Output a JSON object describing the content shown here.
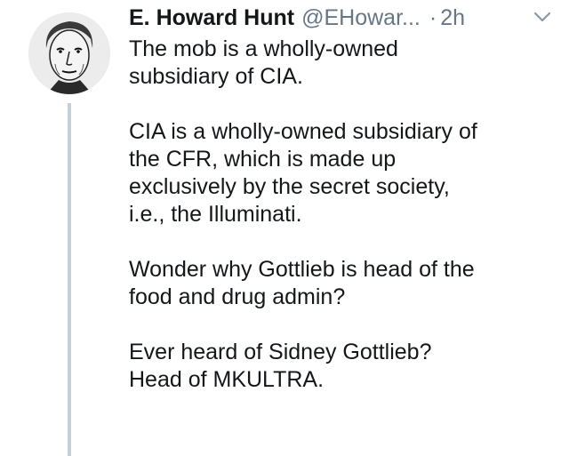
{
  "tweet": {
    "author_name": "E. Howard Hunt",
    "handle": "@EHowar...",
    "separator": "·",
    "time": "2h",
    "paragraphs": [
      [
        "The mob is a wholly-owned",
        "subsidiary of CIA."
      ],
      [
        "CIA is a wholly-owned subsidiary of",
        "the CFR, which is made up",
        "exclusively by the secret society,",
        "i.e., the Illuminati."
      ],
      [
        "Wonder why Gottlieb is head of the",
        "food and drug admin?"
      ],
      [
        "Ever heard of Sidney Gottlieb?",
        "Head of MKULTRA."
      ]
    ]
  },
  "icons": {
    "avatar": "avatar-portrait-icon",
    "caret": "chevron-down-icon"
  },
  "colors": {
    "text": "#14171a",
    "secondary": "#657786",
    "thread_line": "#c4cfd6"
  }
}
